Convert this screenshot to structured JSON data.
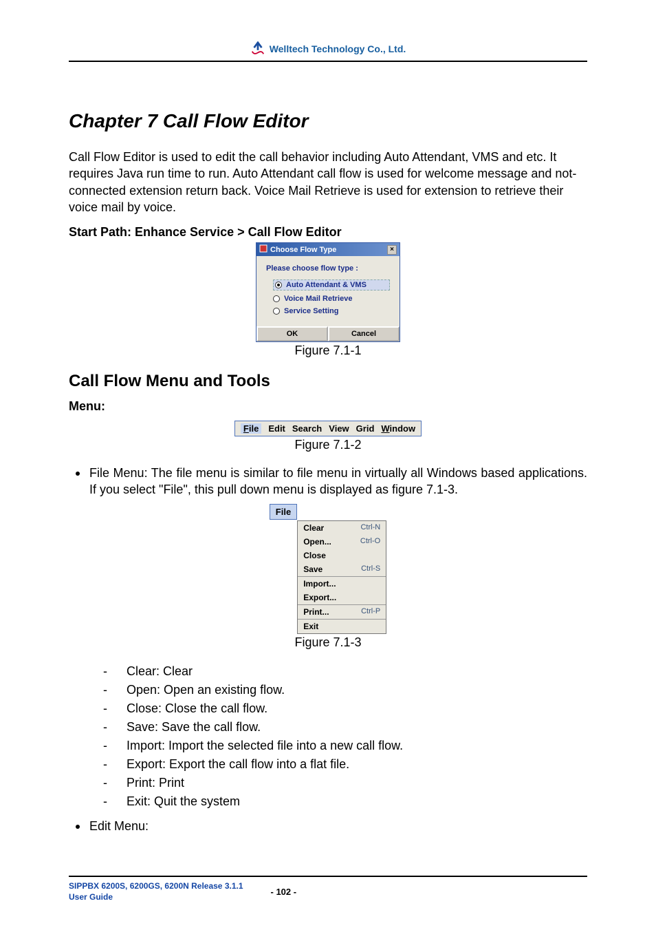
{
  "header": {
    "company": "Welltech Technology Co., Ltd."
  },
  "chapter_title": "Chapter 7 Call Flow Editor",
  "intro": "Call Flow Editor is used to edit the call behavior including Auto Attendant, VMS and etc. It requires Java run time to run. Auto Attendant call flow is used for welcome message and not-connected extension return back. Voice Mail Retrieve is used for extension to retrieve their voice mail by voice.",
  "start_path": "Start Path: Enhance Service > Call Flow Editor",
  "dialog": {
    "title": "Choose Flow Type",
    "prompt": "Please choose flow type :",
    "options": [
      {
        "label": "Auto Attendant & VMS",
        "selected": true
      },
      {
        "label": "Voice Mail Retrieve",
        "selected": false
      },
      {
        "label": "Service Setting",
        "selected": false
      }
    ],
    "ok": "OK",
    "cancel": "Cancel"
  },
  "fig_1": "Figure 7.1-1",
  "section_title": "Call Flow Menu and Tools",
  "menu_label": "Menu:",
  "menubar": [
    "File",
    "Edit",
    "Search",
    "View",
    "Grid",
    "Window"
  ],
  "fig_2": "Figure 7.1-2",
  "file_menu_desc": "File Menu: The file menu is similar to file menu in virtually all Windows based applications. If you select \"File\", this pull down menu is displayed as figure 7.1-3.",
  "file_tab": "File",
  "dropdown_items": [
    {
      "label": "Clear",
      "shortcut": "Ctrl-N"
    },
    {
      "label": "Open...",
      "shortcut": "Ctrl-O"
    },
    {
      "label": "Close",
      "shortcut": ""
    },
    {
      "label": "Save",
      "shortcut": "Ctrl-S"
    },
    {
      "label": "Import...",
      "shortcut": ""
    },
    {
      "label": "Export...",
      "shortcut": ""
    },
    {
      "label": "Print...",
      "shortcut": "Ctrl-P"
    },
    {
      "label": "Exit",
      "shortcut": ""
    }
  ],
  "fig_3": "Figure 7.1-3",
  "definitions": [
    "Clear: Clear",
    "Open: Open an existing flow.",
    "Close: Close the call flow.",
    "Save: Save the call flow.",
    "Import: Import the selected file into a new call flow.",
    "Export: Export the call flow into a flat file.",
    "Print: Print",
    "Exit: Quit the system"
  ],
  "edit_menu_bullet": "Edit Menu:",
  "footer": {
    "line1": "SIPPBX 6200S, 6200GS, 6200N Release 3.1.1",
    "line2": "User Guide",
    "page": "- 102 -"
  }
}
